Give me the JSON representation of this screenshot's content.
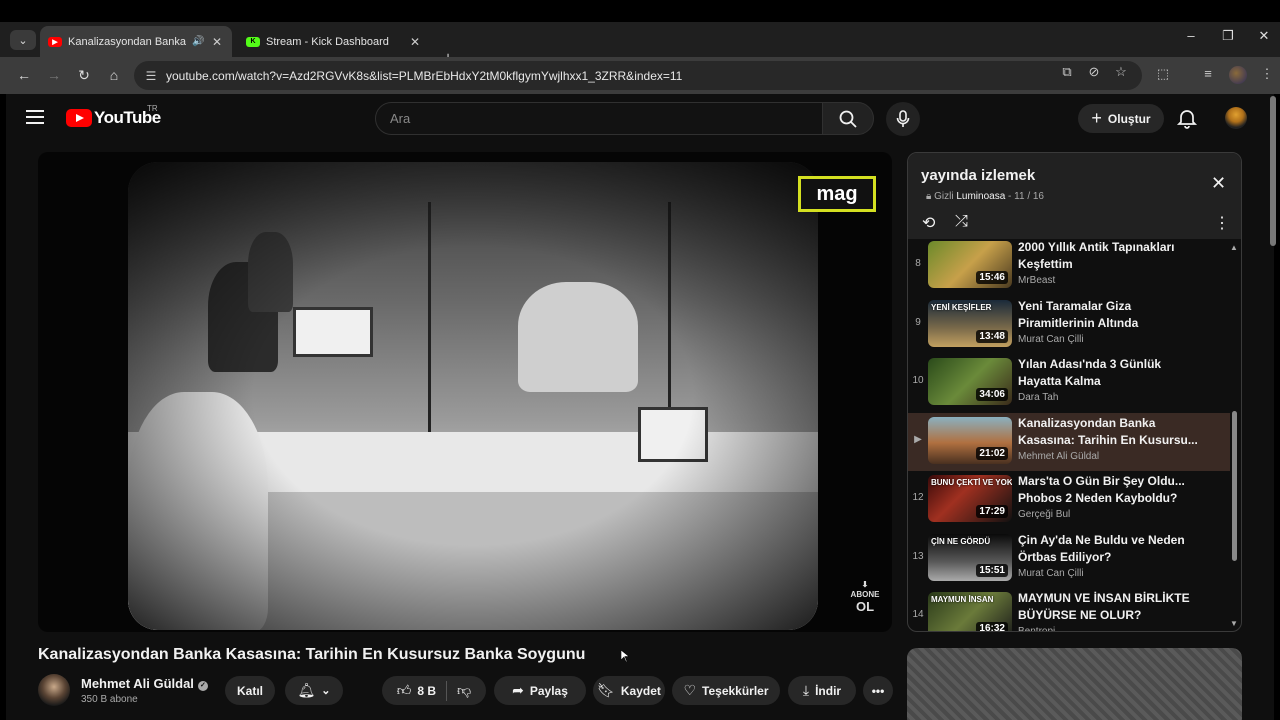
{
  "browser": {
    "tabs": [
      {
        "title": "Kanalizasyondan Banka Kasası",
        "active": true
      },
      {
        "title": "Stream - Kick Dashboard",
        "active": false
      }
    ],
    "url": "youtube.com/watch?v=Azd2RGVvK8s&list=PLMBrEbHdxY2tM0kflgymYwjlhxx1_3ZRR&index=11"
  },
  "header": {
    "logo_text": "YouTube",
    "country_code": "TR",
    "search_placeholder": "Ara",
    "create_label": "Oluştur"
  },
  "video": {
    "title": "Kanalizasyondan Banka Kasasına: Tarihin En Kusursuz Banka Soygunu",
    "watermark": "mag",
    "abone_label": "ABONE",
    "abone_ol": "OL",
    "owner": {
      "name": "Mehmet Ali Güldal",
      "subscribers": "350 B abone"
    },
    "actions": {
      "join": "Katıl",
      "likes": "8 B",
      "share": "Paylaş",
      "save": "Kaydet",
      "thanks": "Teşekkürler",
      "download": "İndir"
    }
  },
  "playlist": {
    "title": "yayında izlemek",
    "privacy": "Gizli",
    "owner": "Luminoasa",
    "position": "11 / 16",
    "items": [
      {
        "index": "8",
        "title": "2000 Yıllık Antik Tapınakları Keşfettim",
        "channel": "MrBeast",
        "duration": "15:46"
      },
      {
        "index": "9",
        "title": "Yeni Taramalar Giza Piramitlerinin Altında Şaşırtıcı...",
        "channel": "Murat Can Çilli",
        "duration": "13:48",
        "thumb_text": "YENİ KEŞİFLER"
      },
      {
        "index": "10",
        "title": "Yılan Adası'nda 3 Günlük Hayatta Kalma",
        "channel": "Dara Tah",
        "duration": "34:06"
      },
      {
        "index": "▶",
        "title": "Kanalizasyondan Banka Kasasına: Tarihin En Kusursu...",
        "channel": "Mehmet Ali Güldal",
        "duration": "21:02"
      },
      {
        "index": "12",
        "title": "Mars'ta O Gün Bir Şey Oldu... Phobos 2 Neden Kayboldu?",
        "channel": "Gerçeği Bul",
        "duration": "17:29",
        "thumb_text": "BUNU ÇEKTİ VE YOK EDİL..."
      },
      {
        "index": "13",
        "title": "Çin Ay'da Ne Buldu ve Neden Örtbas Ediliyor?",
        "channel": "Murat Can Çilli",
        "duration": "15:51",
        "thumb_text": "ÇİN NE GÖRDÜ"
      },
      {
        "index": "14",
        "title": "MAYMUN VE İNSAN BİRLİKTE BÜYÜRSE NE OLUR?",
        "channel": "Bentropi",
        "duration": "16:32",
        "thumb_text": "MAYMUN   İNSAN"
      }
    ]
  },
  "colors": {
    "yt_red": "#ff0000",
    "current_item_bg": "#3a2a24",
    "watermark_border": "#d4e021",
    "kick_green": "#53fc18"
  }
}
